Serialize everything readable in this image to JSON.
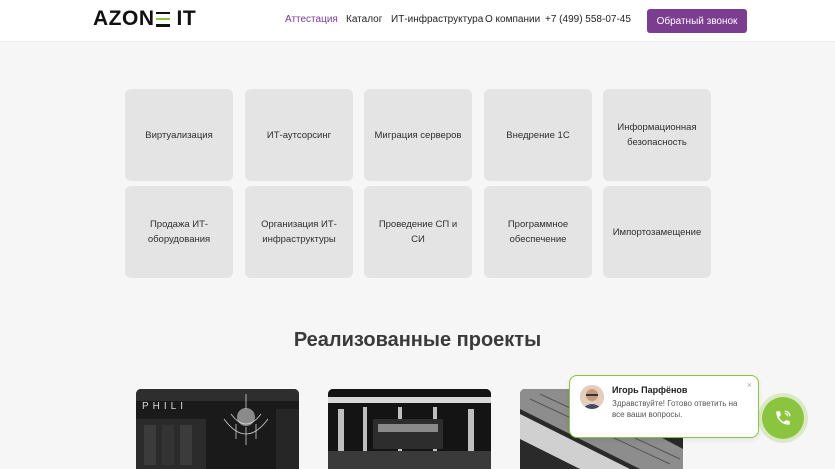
{
  "header": {
    "logo": {
      "left": "AZON",
      "right": "IT"
    },
    "nav": [
      {
        "label": "Аттестация",
        "active": true
      },
      {
        "label": "Каталог",
        "active": false
      },
      {
        "label": "ИТ-инфраструктура",
        "active": false
      },
      {
        "label": "О компании",
        "active": false
      },
      {
        "label": "+7 (499) 558-07-45",
        "active": false
      }
    ],
    "cta_label": "Обратный звонок"
  },
  "services": [
    "Виртуализация",
    "ИТ-аутсорсинг",
    "Миграция серверов",
    "Внедрение 1С",
    "Информационная безопасность",
    "Продажа ИТ-оборудования",
    "Организация ИТ-инфраструктуры",
    "Проведение СП и СИ",
    "Программное обеспечение",
    "Импортозамещение"
  ],
  "projects_section": {
    "title": "Реализованные проекты"
  },
  "chat": {
    "name": "Игорь Парфёнов",
    "message": "Здравствуйте! Готово ответить на все ваши вопросы."
  },
  "colors": {
    "accent": "#7a3d8f",
    "green": "#8bc53f"
  }
}
